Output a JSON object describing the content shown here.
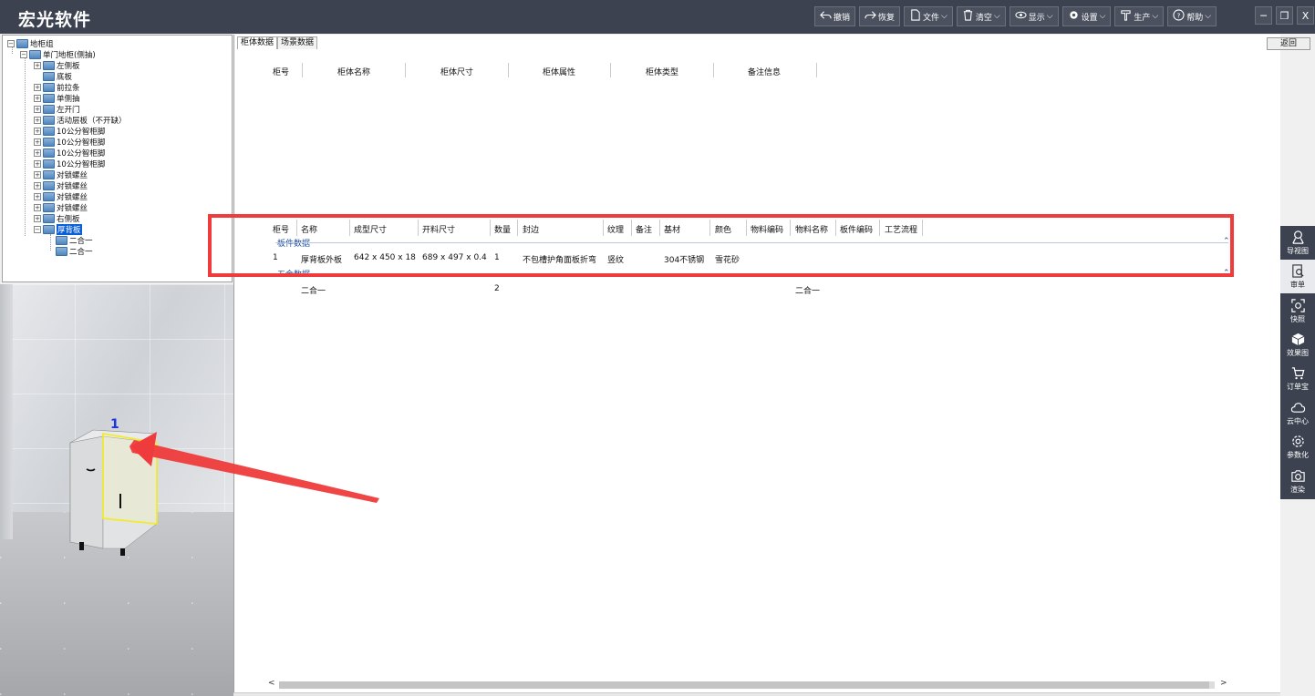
{
  "app": {
    "title": "宏光软件"
  },
  "toolbar": [
    {
      "label": "撤销",
      "icon": "undo-icon"
    },
    {
      "label": "恢复",
      "icon": "redo-icon"
    },
    {
      "label": "文件",
      "icon": "file-icon"
    },
    {
      "label": "清空",
      "icon": "trash-icon"
    },
    {
      "label": "显示",
      "icon": "eye-icon"
    },
    {
      "label": "设置",
      "icon": "gear-icon"
    },
    {
      "label": "生产",
      "icon": "hammer-icon"
    },
    {
      "label": "帮助",
      "icon": "help-icon"
    }
  ],
  "window_controls": [
    "─",
    "❐",
    "X"
  ],
  "tree": {
    "root": "地柜组",
    "cabinet": "单门地柜(侧抽)",
    "items": [
      "左侧板",
      "底板",
      "前拉条",
      "单侧抽",
      "左开门",
      "活动层板（不开缺）",
      "10公分智柜脚",
      "10公分智柜脚",
      "10公分智柜脚",
      "10公分智柜脚",
      "对锁螺丝",
      "对锁螺丝",
      "对锁螺丝",
      "对锁螺丝",
      "右侧板",
      "厚背板"
    ],
    "selected": "厚背板",
    "children": [
      "二合一",
      "二合一"
    ]
  },
  "viewport": {
    "cabinet_number": "1"
  },
  "tabs": [
    "柜体数据",
    "场景数据"
  ],
  "back_button": "返回",
  "cabinet_table": {
    "headers": [
      "柜号",
      "柜体名称",
      "柜体尺寸",
      "柜体属性",
      "柜体类型",
      "备注信息"
    ]
  },
  "board_table": {
    "headers": [
      "柜号",
      "名称",
      "成型尺寸",
      "开料尺寸",
      "数量",
      "封边",
      "纹理",
      "备注",
      "基材",
      "颜色",
      "物料编码",
      "物料名称",
      "板件编码",
      "工艺流程"
    ],
    "group1_label": "板件数据",
    "group1_rows": [
      [
        "1",
        "厚背板外板",
        "642 x 450 x 18",
        "689 x 497 x 0.4",
        "1",
        "不包槽护角面板折弯",
        "竖纹",
        "",
        "304不锈钢",
        "雪花砂",
        "",
        "",
        "",
        ""
      ]
    ],
    "group2_label": "五金数据",
    "group2_rows": [
      [
        "",
        "二合一",
        "",
        "",
        "2",
        "",
        "",
        "",
        "",
        "",
        "",
        "二合一",
        "",
        ""
      ]
    ]
  },
  "rightbar": [
    {
      "label": "导视图",
      "icon": "navigator-icon"
    },
    {
      "label": "审单",
      "icon": "review-icon",
      "active": true
    },
    {
      "label": "快照",
      "icon": "snapshot-icon"
    },
    {
      "label": "效果图",
      "icon": "render-cube-icon"
    },
    {
      "label": "订单宝",
      "icon": "cart-icon"
    },
    {
      "label": "云中心",
      "icon": "cloud-icon"
    },
    {
      "label": "参数化",
      "icon": "param-gear-icon"
    },
    {
      "label": "渲染",
      "icon": "camera-icon"
    }
  ],
  "colors": {
    "titlebar": "#3c4250",
    "highlight_box": "#ef3b3b",
    "selection": "#0a5fd8",
    "link": "#1a4fa0"
  }
}
